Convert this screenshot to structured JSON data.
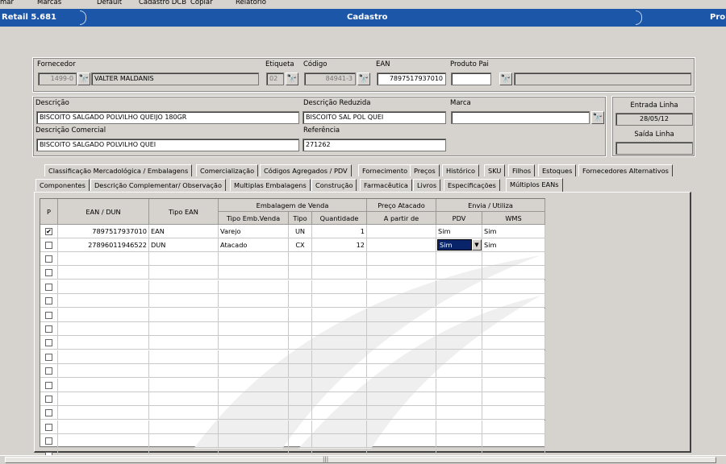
{
  "menubar": [
    "mar",
    "Marcas",
    "Default",
    "Cadastro DCB",
    "Copiar",
    "Relatório"
  ],
  "titlebar": {
    "left": "Retail 5.681",
    "center": "Cadastro",
    "right": "Pro"
  },
  "header": {
    "fornecedor_label": "Fornecedor",
    "fornecedor_code": "1499-0",
    "fornecedor_name": "VALTER MALDANIS",
    "etiqueta_label": "Etiqueta",
    "etiqueta_value": "02",
    "codigo_label": "Código",
    "codigo_value": "84941-3",
    "ean_label": "EAN",
    "ean_value": "7897517937010",
    "produto_pai_label": "Produto Pai",
    "produto_pai_value": "",
    "produto_pai_desc": ""
  },
  "descricao": {
    "descricao_label": "Descrição",
    "descricao_value": "BISCOITO SALGADO POLVILHO QUEIJO 180GR",
    "reduzida_label": "Descrição Reduzida",
    "reduzida_value": "BISCOITO SAL POL QUEI",
    "marca_label": "Marca",
    "marca_value": "",
    "comercial_label": "Descrição Comercial",
    "comercial_value": "BISCOITO SALGADO POLVILHO QUEI",
    "referencia_label": "Referência",
    "referencia_value": "271262",
    "entrada_label": "Entrada Linha",
    "entrada_value": "28/05/12",
    "saida_label": "Saída Linha",
    "saida_value": ""
  },
  "tabs_row1": [
    "Classificação Mercadológica / Embalagens",
    "Comercialização",
    "Códigos Agregados / PDV",
    "Fornecimento",
    "Preços",
    "Histórico",
    "SKU",
    "Filhos",
    "Estoques",
    "Fornecedores Alternativos"
  ],
  "tabs_row2": [
    "Componentes",
    "Descrição Complementar/ Observação",
    "Multiplas Embalagens",
    "Construção",
    "Farmacêutica",
    "Livros",
    "Especificações",
    "Múltiplos EANs"
  ],
  "grid": {
    "h_p": "P",
    "h_ean": "EAN / DUN",
    "h_tipo_ean": "Tipo EAN",
    "h_emb_group": "Embalagem de Venda",
    "h_tipo_emb": "Tipo Emb.Venda",
    "h_tipo": "Tipo",
    "h_qtd": "Quantidade",
    "h_preco_group": "Preço Atacado",
    "h_apartir": "A partir de",
    "h_envia_group": "Envia / Utiliza",
    "h_pdv": "PDV",
    "h_wms": "WMS",
    "rows": [
      {
        "p": true,
        "ean": "7897517937010",
        "tipo_ean": "EAN",
        "tipo_emb": "Varejo",
        "tipo": "UN",
        "qtd": "1",
        "apartir": "",
        "pdv": "Sim",
        "wms": "Sim"
      },
      {
        "p": false,
        "ean": "27896011946522",
        "tipo_ean": "DUN",
        "tipo_emb": "Atacado",
        "tipo": "CX",
        "qtd": "12",
        "apartir": "",
        "pdv": "Sim",
        "wms": "Sim"
      }
    ]
  }
}
